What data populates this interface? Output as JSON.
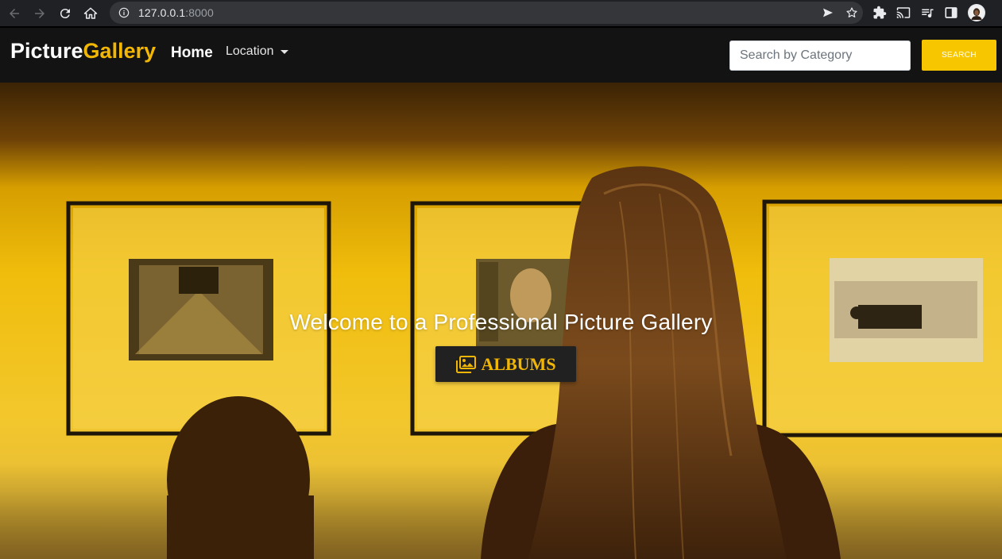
{
  "browser": {
    "url_host": "127.0.0.1",
    "url_port": ":8000",
    "back_icon": "arrow-left-icon",
    "forward_icon": "arrow-right-icon",
    "reload_icon": "reload-icon",
    "home_icon": "home-icon",
    "info_icon": "info-icon",
    "send_icon": "send-icon",
    "bookmark_icon": "star-icon",
    "extensions_icon": "puzzle-icon",
    "cast_icon": "cast-icon",
    "media_icon": "queue-music-icon",
    "sidepanel_icon": "side-panel-icon",
    "profile_icon": "avatar"
  },
  "navbar": {
    "brand_part1": "Picture",
    "brand_part2": "Gallery",
    "home_label": "Home",
    "location_label": "Location",
    "search_placeholder": "Search by Category",
    "search_button": "SEARCH",
    "colors": {
      "background": "#131313",
      "accent": "#f2b705",
      "search_button": "#f7c600"
    }
  },
  "hero": {
    "welcome_text": "Welcome to a Professional Picture Gallery",
    "albums_label": "ALBUMS",
    "albums_icon": "images-icon",
    "colors": {
      "button_background": "#212121",
      "button_text": "#f2b705"
    }
  }
}
